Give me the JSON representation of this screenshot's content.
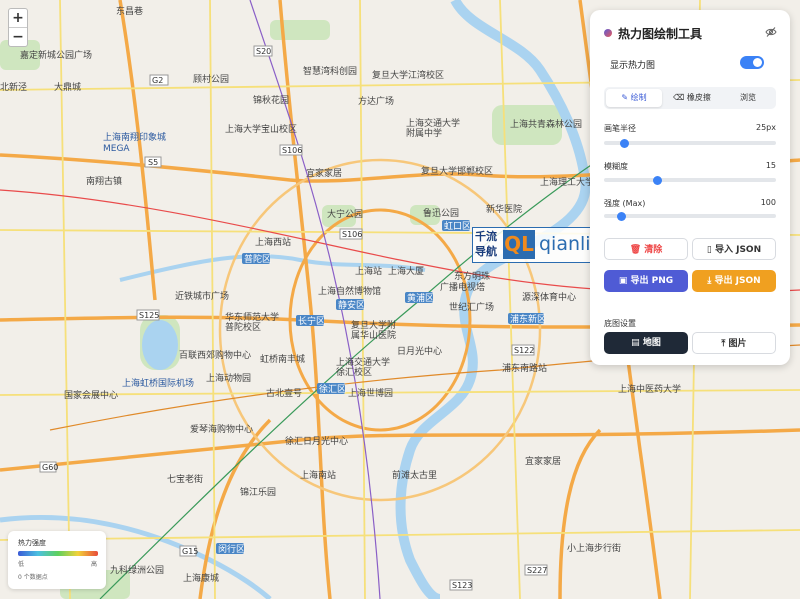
{
  "zoom": {
    "in_label": "+",
    "out_label": "−"
  },
  "panel": {
    "title": "热力图绘制工具",
    "icons": {
      "title": "gradient-dot",
      "visibility": "eye-off-icon"
    },
    "show_heatmap_label": "显示热力图",
    "show_heatmap_on": true,
    "tabs": [
      {
        "label": "绘制",
        "active": true,
        "icon": "brush-icon"
      },
      {
        "label": "橡皮擦",
        "active": false,
        "icon": "eraser-icon"
      },
      {
        "label": "浏览",
        "active": false
      }
    ],
    "sliders": {
      "radius": {
        "label": "画笔半径",
        "value": "25px",
        "fraction": 0.12
      },
      "blur": {
        "label": "模糊度",
        "value": "15",
        "fraction": 0.31
      },
      "intensity": {
        "label": "强度 (Max)",
        "value": "100",
        "fraction": 0.1
      }
    },
    "buttons": {
      "clear": "清除",
      "import_json": "导入 JSON",
      "export_png": "导出 PNG",
      "export_json": "导出 JSON",
      "basemap_map": "地图",
      "basemap_image": "图片"
    },
    "basemap_label": "底图设置"
  },
  "legend": {
    "title": "热力强度",
    "low": "低",
    "high": "高",
    "count": "0 个数据点"
  },
  "watermark": {
    "cn_top": "千流",
    "cn_bottom": "导航",
    "ql": "QL",
    "site": "qianliu.com"
  },
  "map_labels": {
    "places": [
      "东昌巷",
      "嘉定新城公园广场",
      "北新泾",
      "大鼎城",
      "上海南翔印象城MEGA",
      "南翔古镇",
      "顾村公园",
      "锦秋花园",
      "上海大学宝山校区",
      "智慧湾科创园",
      "复旦大学江湾校区",
      "方达广场",
      "上海交通大学附属中学",
      "上海共青森林公园",
      "上海理工大学",
      "复旦大学邯郸校区",
      "宜家家居",
      "大宁公园",
      "鲁迅公园",
      "新华医院",
      "上海西站",
      "上海自然博物馆",
      "上海站",
      "上海大厦",
      "东方明珠广播电视塔",
      "近铁城市广场",
      "华东师范大学普陀校区",
      "复旦大学附属华山医院",
      "世纪汇广场",
      "源深体育中心",
      "长宁区",
      "日月光中心",
      "上海交通大学徐汇校区",
      "浦东南路站",
      "虹桥南丰城",
      "百联西郊购物中心",
      "上海动物园",
      "上海虹桥国际机场",
      "国家会展中心",
      "古北壹号",
      "上海世博园",
      "爱琴海购物中心",
      "徐汇日月光中心",
      "上海中医药大学",
      "七宝老街",
      "上海南站",
      "前滩太古里",
      "锦江乐园",
      "九科绿洲公园",
      "上海康城",
      "小上海步行街"
    ],
    "districts": [
      "虹口区",
      "普陀区",
      "静安区",
      "黄浦区",
      "浦东新区",
      "徐汇区",
      "闵行区"
    ],
    "roads": [
      "S20",
      "S5",
      "S106",
      "S126",
      "S122",
      "S125",
      "G60",
      "S4",
      "S227",
      "S123",
      "G2",
      "G15"
    ]
  }
}
